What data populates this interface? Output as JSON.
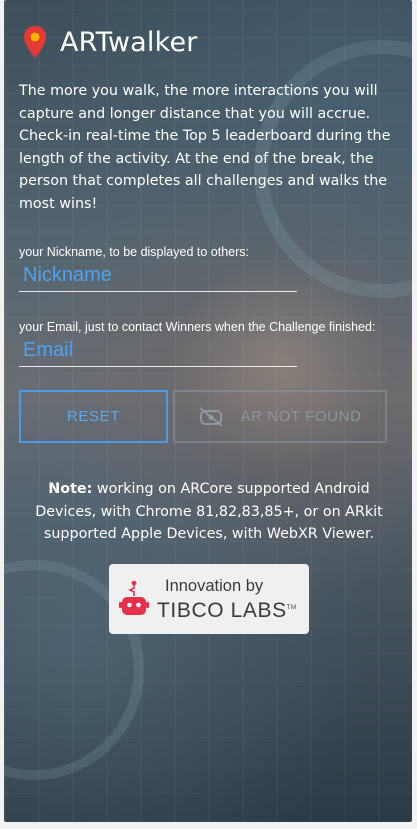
{
  "app": {
    "title": "ARTwalker"
  },
  "intro": {
    "text": "The more you walk, the more interactions you will capture and longer distance that you will accrue. Check-in real-time the Top 5 leaderboard during the length of the activity. At the end of the break, the person that completes all challenges and walks the most wins!"
  },
  "form": {
    "nickname_label": "your Nickname, to be displayed to others:",
    "nickname_placeholder": "Nickname",
    "nickname_value": "",
    "email_label": "your Email, just to contact Winners when the Challenge finished:",
    "email_placeholder": "Email",
    "email_value": ""
  },
  "buttons": {
    "reset_label": "RESET",
    "ar_label": "AR NOT FOUND"
  },
  "note": {
    "bold": "Note:",
    "text": " working on ARCore supported Android Devices, with Chrome 81,82,83,85+, or on ARkit supported Apple Devices, with WebXR Viewer."
  },
  "badge": {
    "line1": "Innovation by",
    "line2": "TIBCO LABS",
    "tm": "TM"
  },
  "icons": {
    "pin": "map-pin-icon",
    "ar": "eye-off-icon",
    "badge": "robot-icon"
  },
  "colors": {
    "pin": "#e53935",
    "accent_blue": "#4a9ae6",
    "placeholder_blue": "#4aa3f3",
    "disabled": "#8c96a0",
    "badge_bg": "#f0f0f0",
    "robot_red": "#e5304a"
  }
}
